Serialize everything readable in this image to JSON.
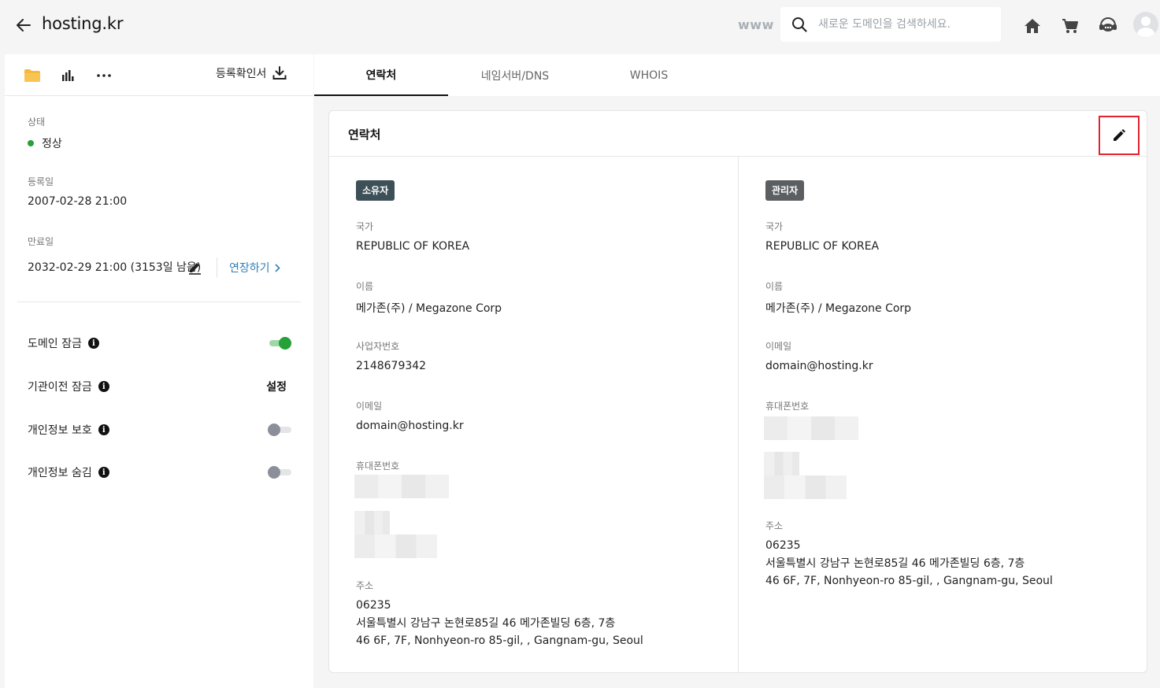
{
  "header": {
    "title": "hosting.kr",
    "www_label": "www",
    "search_placeholder": "새로운 도메인을 검색하세요."
  },
  "sidebar": {
    "cert_label": "등록확인서",
    "status_label": "상태",
    "status_value": "정상",
    "registered_label": "등록일",
    "registered_value": "2007-02-28 21:00",
    "expiry_label": "만료일",
    "expiry_value": "2032-02-29 21:00 (3153일 남음)",
    "extend_label": "연장하기",
    "options": [
      {
        "label": "도메인 잠금",
        "control": "toggle",
        "on": true
      },
      {
        "label": "기관이전 잠금",
        "control": "button",
        "button_label": "설정"
      },
      {
        "label": "개인정보 보호",
        "control": "toggle",
        "on": false
      },
      {
        "label": "개인정보 숨김",
        "control": "toggle",
        "on": false
      }
    ]
  },
  "tabs": [
    {
      "label": "연락처",
      "active": true
    },
    {
      "label": "네임서버/DNS",
      "active": false
    },
    {
      "label": "WHOIS",
      "active": false
    }
  ],
  "contact_card": {
    "title": "연락처",
    "owner": {
      "badge": "소유자",
      "country_label": "국가",
      "country": "REPUBLIC OF KOREA",
      "name_label": "이름",
      "name": "메가존(주) / Megazone Corp",
      "bizno_label": "사업자번호",
      "bizno": "2148679342",
      "email_label": "이메일",
      "email": "domain@hosting.kr",
      "phone_label": "휴대폰번호",
      "address_label": "주소",
      "zipcode": "06235",
      "address_line1": "서울특별시 강남구 논현로85길 46 메가존빌딩 6층, 7층",
      "address_line2": "46 6F, 7F, Nonhyeon-ro 85-gil, , Gangnam-gu, Seoul"
    },
    "admin": {
      "badge": "관리자",
      "country_label": "국가",
      "country": "REPUBLIC OF KOREA",
      "name_label": "이름",
      "name": "메가존(주) / Megazone Corp",
      "email_label": "이메일",
      "email": "domain@hosting.kr",
      "phone_label": "휴대폰번호",
      "address_label": "주소",
      "zipcode": "06235",
      "address_line1": "서울특별시 강남구 논현로85길 46 메가존빌딩 6층, 7층",
      "address_line2": "46 6F, 7F, Nonhyeon-ro 85-gil, , Gangnam-gu, Seoul"
    }
  },
  "colors": {
    "accent_link": "#2e7fb8",
    "status_ok": "#26a038",
    "highlight_border": "#e0242f",
    "owner_badge": "#3d4f57",
    "admin_badge": "#5c5f62"
  },
  "icons": [
    "back-arrow-icon",
    "search-icon",
    "home-icon",
    "cart-icon",
    "support-chat-icon",
    "avatar-icon",
    "folder-icon",
    "bar-chart-icon",
    "more-icon",
    "download-icon",
    "pencil-icon",
    "chevron-right-icon",
    "info-icon"
  ]
}
